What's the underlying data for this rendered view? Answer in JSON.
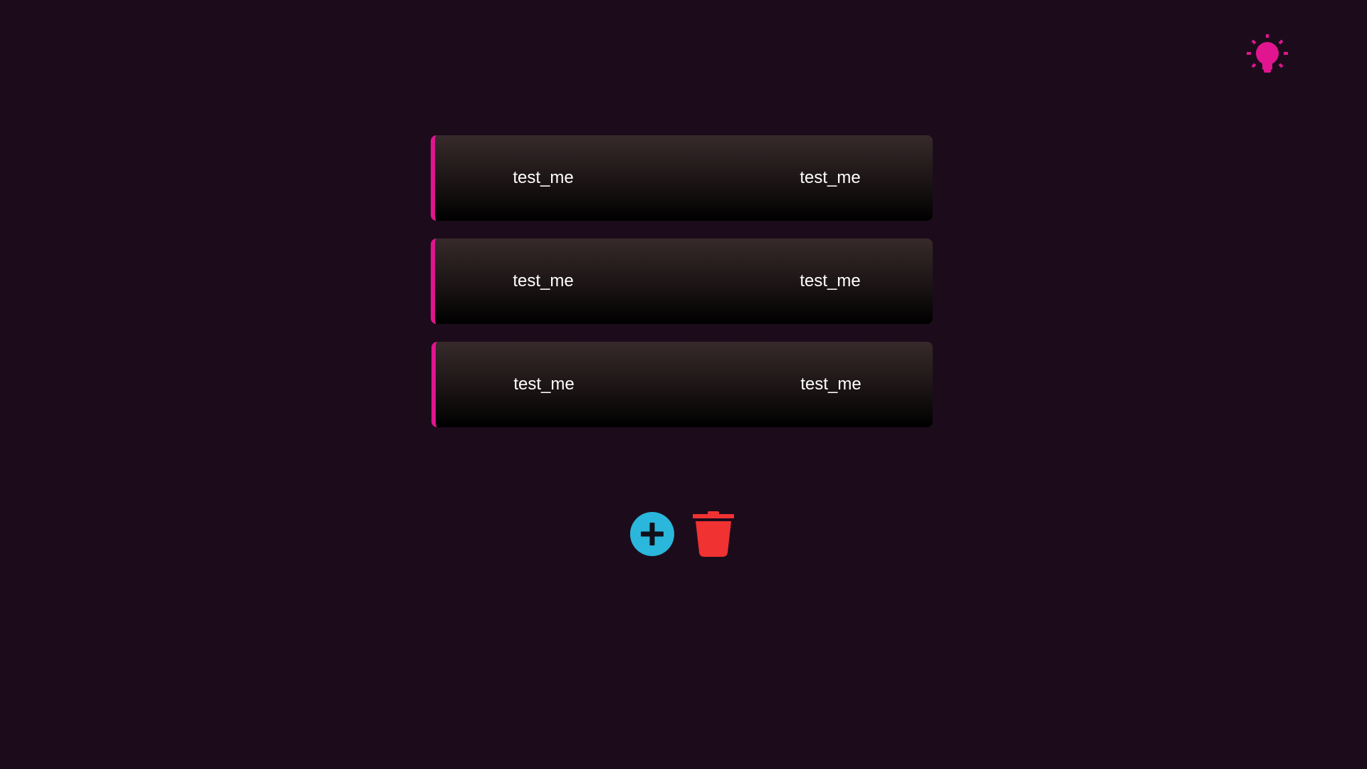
{
  "header": {
    "theme_toggle_icon": "lightbulb-icon",
    "accent_color": "#e0158f"
  },
  "rows": [
    {
      "left": "test_me",
      "right": "test_me"
    },
    {
      "left": "test_me",
      "right": "test_me"
    },
    {
      "left": "test_me",
      "right": "test_me"
    }
  ],
  "actions": {
    "add_icon": "plus-circle-icon",
    "add_color": "#2bb6dc",
    "delete_icon": "trash-icon",
    "delete_color": "#f03232"
  },
  "colors": {
    "background": "#1c0c1b",
    "row_accent": "#e0158f",
    "text": "#ffffff"
  }
}
